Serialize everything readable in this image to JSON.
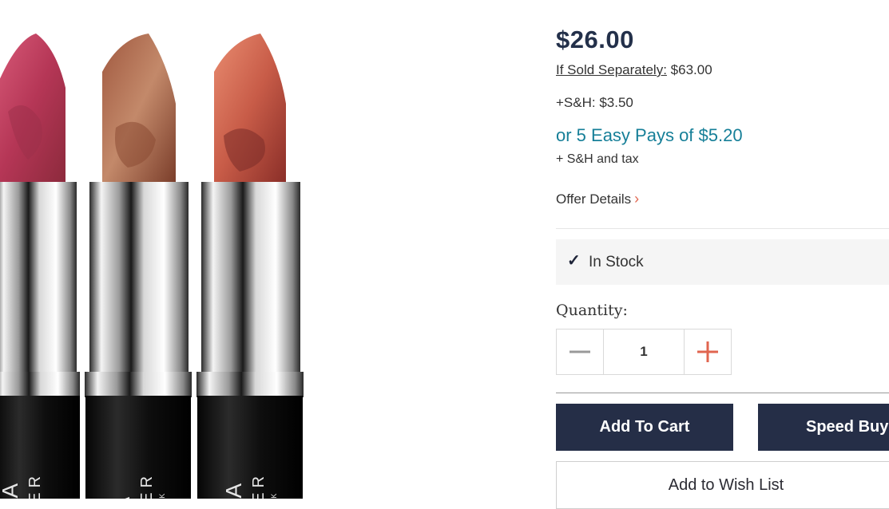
{
  "product": {
    "brand_lines": [
      "URA",
      "LLER",
      "W YORK"
    ]
  },
  "pricing": {
    "price": "$26.00",
    "sold_separately_label": "If Sold Separately:",
    "sold_separately_value": "$63.00",
    "shipping": "+S&H: $3.50",
    "easy_pay": "or 5 Easy Pays of $5.20",
    "easy_pay_note": "+ S&H and tax",
    "offer_details": "Offer Details",
    "chevron": "›"
  },
  "stock": {
    "check": "✓",
    "status": "In Stock"
  },
  "quantity": {
    "label": "Quantity:",
    "value": "1"
  },
  "actions": {
    "add_to_cart": "Add To Cart",
    "speed_buy": "Speed Buy",
    "add_to_wish_list": "Add to Wish List"
  },
  "colors": {
    "navy": "#252e47",
    "teal": "#167f98",
    "accent": "#e0654f"
  }
}
